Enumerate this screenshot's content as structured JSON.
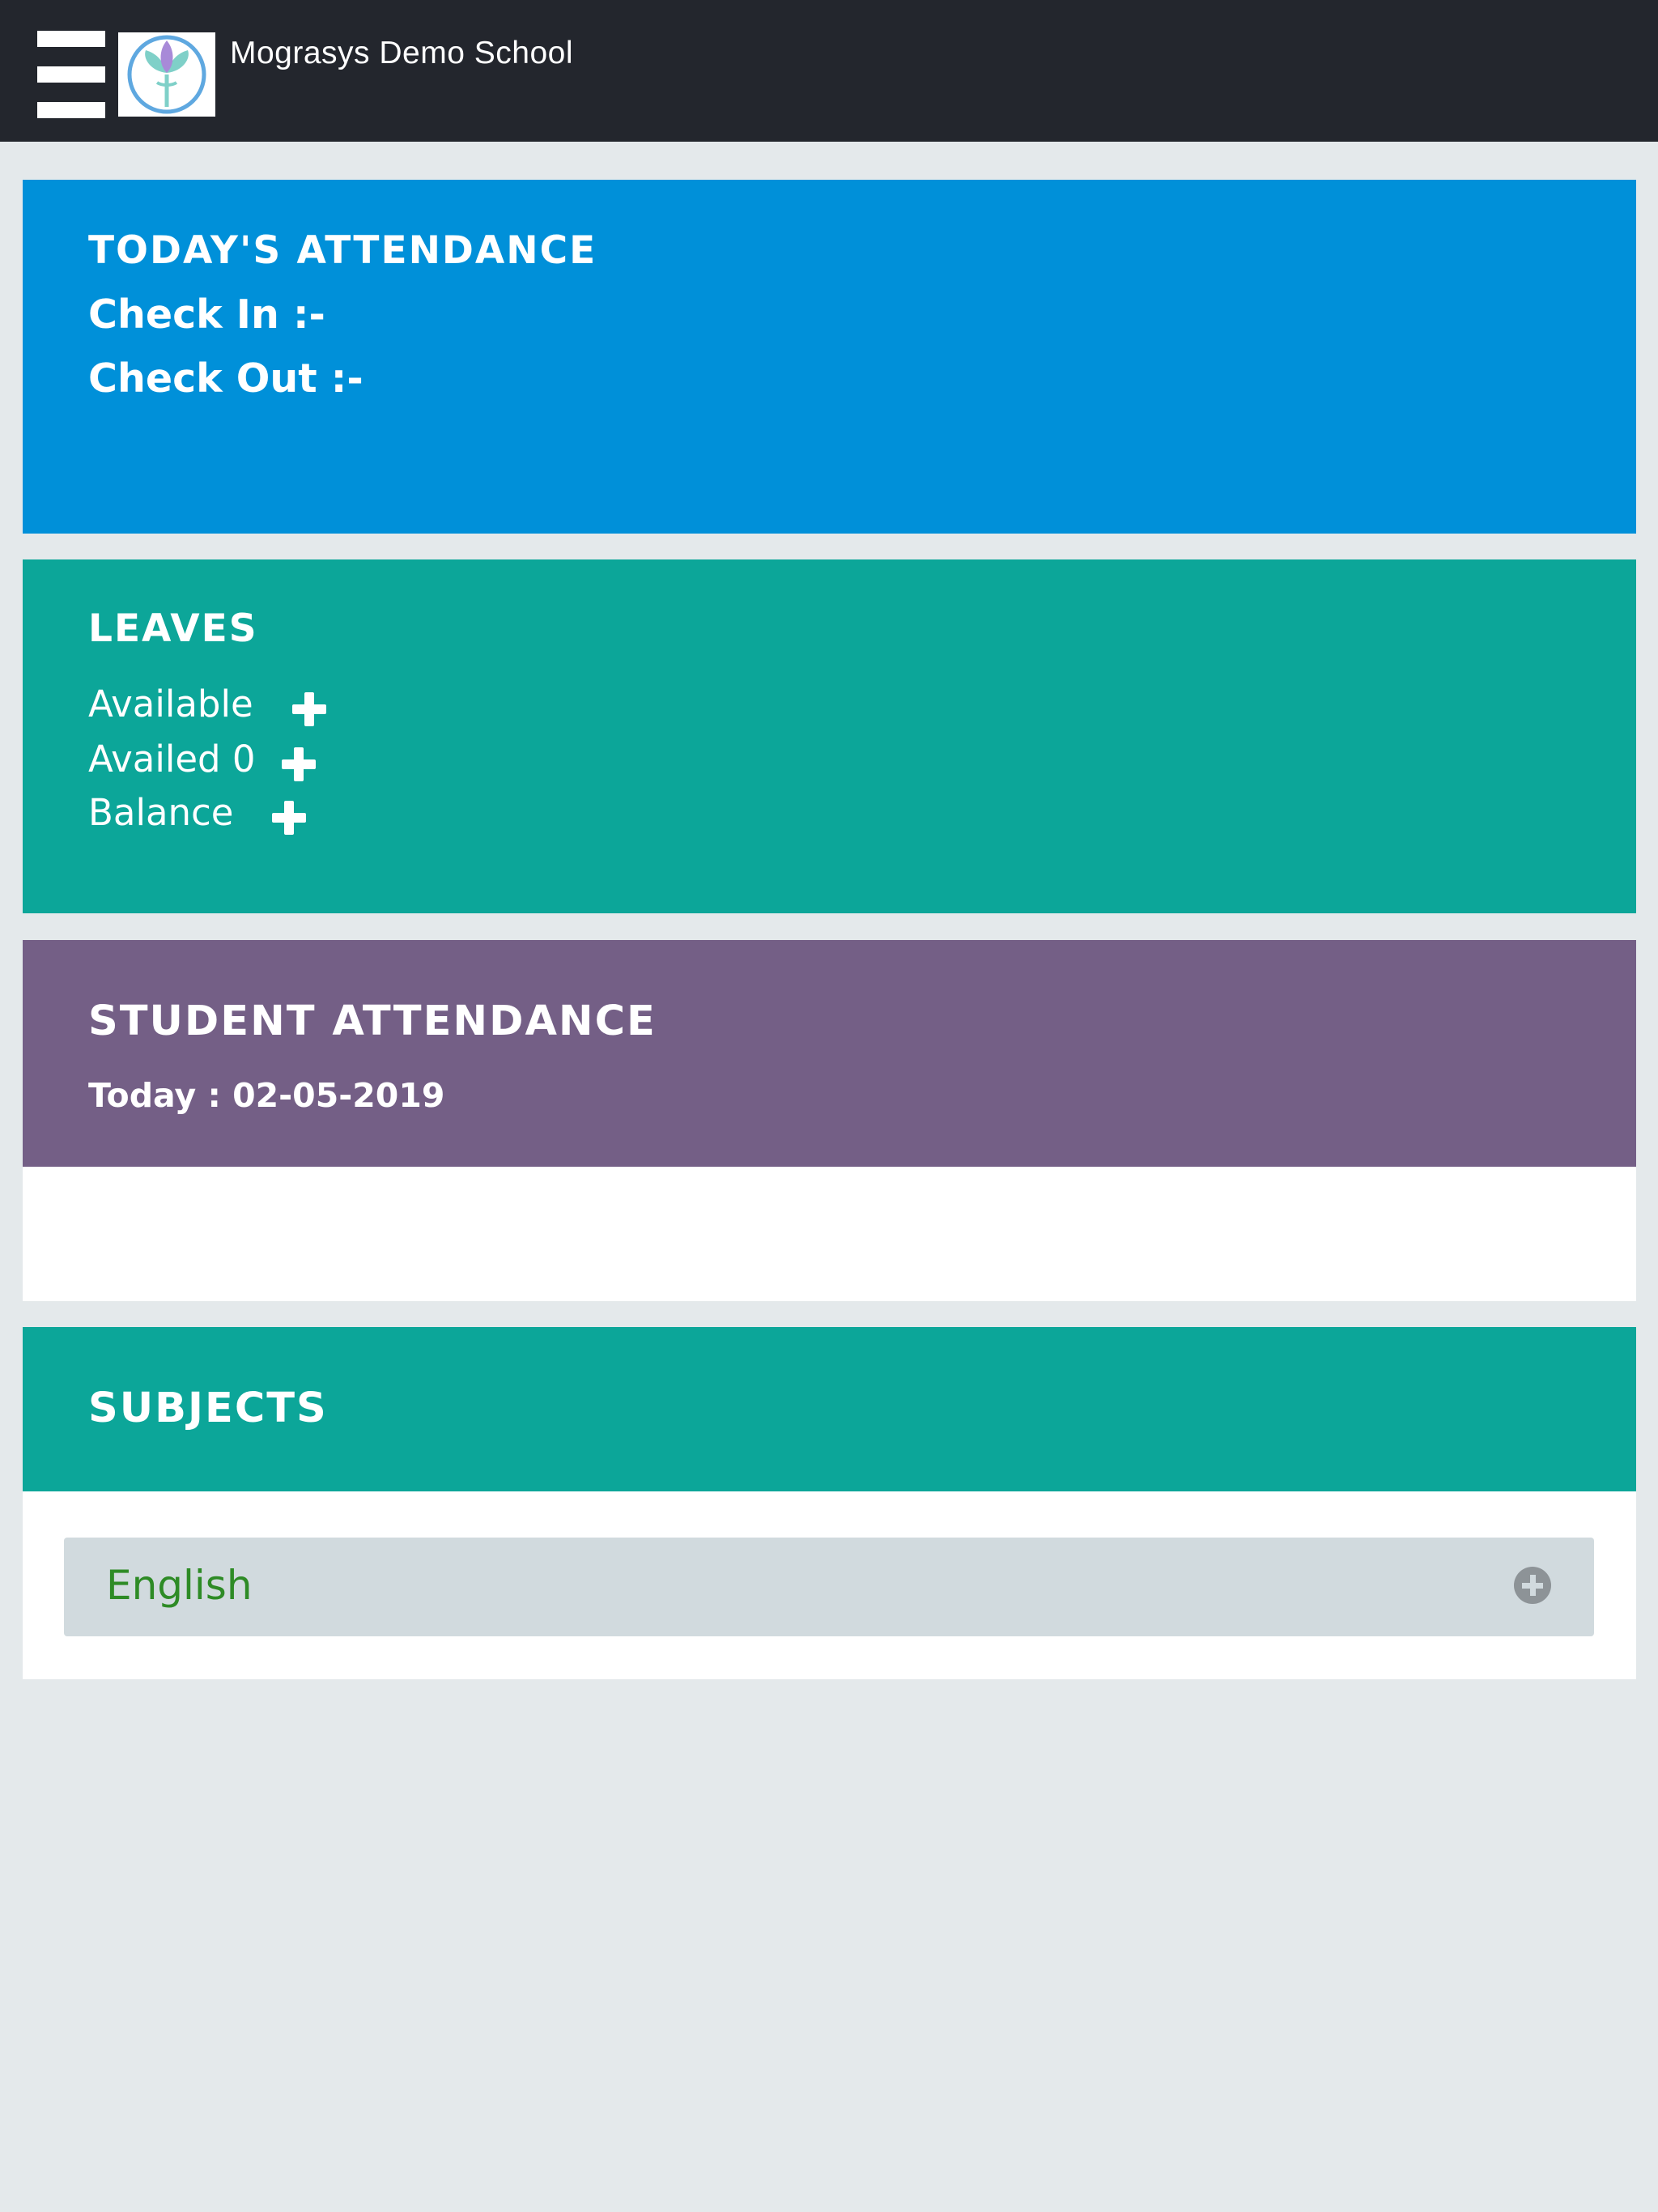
{
  "header": {
    "menu_icon": "hamburger-menu-icon",
    "logo_icon": "school-logo-icon",
    "title": "Mograsys Demo School"
  },
  "todays_attendance": {
    "title": "TODAY'S ATTENDANCE",
    "check_in": "Check In :-",
    "check_out": "Check Out :-",
    "color": "#0090d9"
  },
  "leaves": {
    "title": "LEAVES",
    "available": "Available",
    "availed": "Availed 0",
    "balance": "Balance",
    "expand_icon": "plus-icon",
    "color": "#0ca699"
  },
  "student_attendance": {
    "title": "STUDENT ATTENDANCE",
    "today": "Today : 02-05-2019",
    "color": "#745f86"
  },
  "subjects": {
    "title": "SUBJECTS",
    "items": [
      {
        "name": "English",
        "icon": "circle-plus-icon"
      }
    ],
    "color": "#0ca699",
    "subject_text_color": "#2e8b26"
  }
}
